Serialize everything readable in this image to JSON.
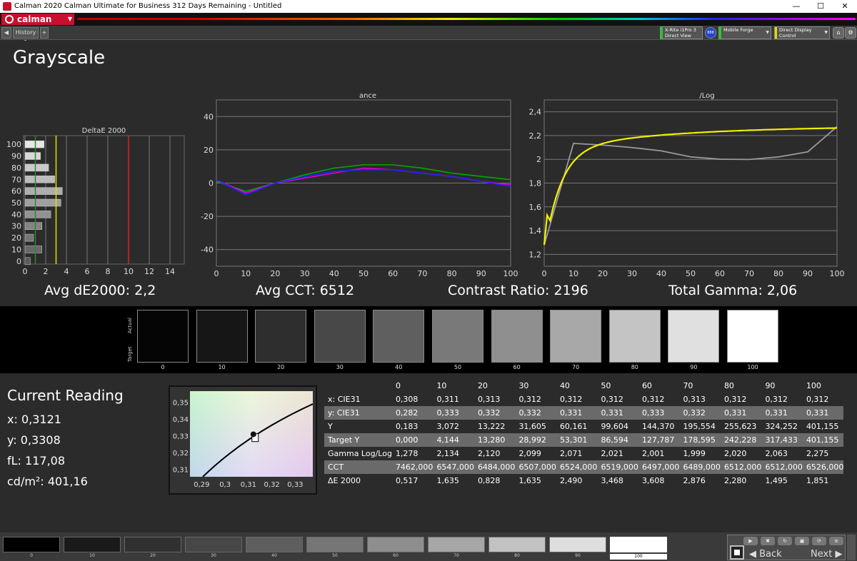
{
  "window": {
    "title": "Calman 2020 Calman Ultimate for Business 312 Days Remaining - Untitled",
    "minimize": "—",
    "maximize": "☐",
    "close": "✕"
  },
  "logo": {
    "text": "calman",
    "dropdown": "▼"
  },
  "tabs": {
    "back_arrow": "◀",
    "history_tab": "History 1",
    "add_tab": "+"
  },
  "devices": [
    {
      "line1": "X-Rite i1Pro 3",
      "line2": "Direct View",
      "color": "#22cc22"
    },
    {
      "line1": "Mobile Forge",
      "line2": "",
      "color": "#22cc22"
    },
    {
      "line1": "Direct Display Control",
      "line2": "",
      "color": "#dddd00"
    }
  ],
  "device_badge": "888",
  "page_title": "Grayscale",
  "deltae_chart": {
    "title": "DeltaE 2000",
    "categories": [
      "0",
      "10",
      "20",
      "30",
      "40",
      "50",
      "60",
      "70",
      "80",
      "90",
      "100"
    ],
    "x_ticks": [
      "0",
      "2",
      "4",
      "6",
      "8",
      "10",
      "12",
      "14"
    ],
    "y_ticks": [
      "100",
      "90",
      "80",
      "70",
      "60",
      "50",
      "40",
      "30",
      "20",
      "10",
      "0"
    ]
  },
  "rgb_chart": {
    "title": "RGB Balance",
    "visible_title": "ance",
    "x_ticks": [
      "0",
      "10",
      "20",
      "30",
      "40",
      "50",
      "60",
      "70",
      "80",
      "90",
      "100"
    ],
    "y_ticks": [
      "40",
      "20",
      "0",
      "-20",
      "-40"
    ]
  },
  "gamma_chart": {
    "visible_title": "/Log",
    "x_ticks": [
      "0",
      "10",
      "20",
      "30",
      "40",
      "50",
      "60",
      "70",
      "80",
      "90",
      "100"
    ],
    "y_ticks": [
      "2,4",
      "2,2",
      "2",
      "1,8",
      "1,6",
      "1,4",
      "1,2"
    ]
  },
  "chart_data": [
    {
      "type": "bar",
      "title": "DeltaE 2000",
      "orientation": "horizontal",
      "categories": [
        "0",
        "10",
        "20",
        "30",
        "40",
        "50",
        "60",
        "70",
        "80",
        "90",
        "100"
      ],
      "values": [
        0.517,
        1.635,
        0.828,
        1.635,
        2.49,
        3.468,
        3.608,
        2.876,
        2.28,
        1.495,
        1.851
      ],
      "xlim": [
        0,
        15
      ],
      "reference_lines": [
        {
          "value": 3,
          "color": "#e0e000"
        },
        {
          "value": 10,
          "color": "#dd2222"
        }
      ]
    },
    {
      "type": "line",
      "x": [
        0,
        10,
        20,
        30,
        40,
        50,
        60,
        70,
        80,
        90,
        100
      ],
      "ylim": [
        -50,
        50
      ],
      "series": [
        {
          "color": "#00aa00",
          "values": [
            1,
            -5,
            0,
            5,
            9,
            11,
            11,
            9,
            6,
            4,
            2
          ]
        },
        {
          "color": "#dd00dd",
          "values": [
            2,
            -6,
            0,
            3,
            6,
            9,
            8,
            6,
            4,
            1,
            -1
          ]
        },
        {
          "color": "#2222ff",
          "values": [
            2,
            -7,
            0,
            4,
            7,
            8,
            8,
            6,
            4,
            1,
            -2
          ]
        }
      ]
    },
    {
      "type": "line",
      "x": [
        0,
        10,
        20,
        30,
        40,
        50,
        60,
        70,
        80,
        90,
        100
      ],
      "ylim": [
        1.1,
        2.5
      ],
      "series": [
        {
          "color": "#9a9a9a",
          "values": [
            1.278,
            2.134,
            2.12,
            2.099,
            2.071,
            2.021,
            2.001,
            1.999,
            2.02,
            2.063,
            2.275
          ]
        },
        {
          "color": "#f0f000",
          "curve": "gamma",
          "values": [
            1.28,
            1.95,
            2.08,
            2.13,
            2.16,
            2.19,
            2.21,
            2.23,
            2.25,
            2.27,
            2.28
          ]
        }
      ]
    },
    {
      "type": "scatter",
      "x_ticks": [
        "0,29",
        "0,3",
        "0,31",
        "0,32",
        "0,33"
      ],
      "y_ticks": [
        "0,35",
        "0,34",
        "0,33",
        "0,32",
        "0,31"
      ],
      "xlim": [
        0.285,
        0.3375
      ],
      "ylim": [
        0.3055,
        0.3565
      ],
      "points": [
        {
          "x": 0.3127,
          "y": 0.329,
          "label": "target"
        },
        {
          "x": 0.3121,
          "y": 0.3308,
          "label": "measured"
        }
      ]
    }
  ],
  "stats": {
    "avg_de": "Avg dE2000: 2,2",
    "avg_cct": "Avg CCT: 6512",
    "contrast": "Contrast Ratio: 2196",
    "total_gamma": "Total Gamma: 2,06"
  },
  "patches": {
    "actual_label": "Actual",
    "target_label": "Target",
    "labels": [
      "0",
      "10",
      "20",
      "30",
      "40",
      "50",
      "60",
      "70",
      "80",
      "90",
      "100"
    ],
    "actual_colors": [
      "#050505",
      "#161616",
      "#2e2e2e",
      "#484848",
      "#5f5f5f",
      "#797979",
      "#8f8f8f",
      "#a8a8a8",
      "#c4c4c4",
      "#e0e0e0",
      "#ffffff"
    ],
    "target_colors": [
      "#050505",
      "#161616",
      "#2e2e2e",
      "#484848",
      "#5f5f5f",
      "#797979",
      "#8f8f8f",
      "#a8a8a8",
      "#c4c4c4",
      "#e0e0e0",
      "#ffffff"
    ]
  },
  "current_reading": {
    "title": "Current Reading",
    "x": "x: 0,3121",
    "y": "y: 0,3308",
    "fl": "fL: 117,08",
    "cd": "cd/m²: 401,16"
  },
  "table": {
    "headers": [
      "",
      "0",
      "10",
      "20",
      "30",
      "40",
      "50",
      "60",
      "70",
      "80",
      "90",
      "100"
    ],
    "rows": [
      [
        "x: CIE31",
        "0,308",
        "0,311",
        "0,313",
        "0,312",
        "0,312",
        "0,312",
        "0,312",
        "0,313",
        "0,312",
        "0,312",
        "0,312"
      ],
      [
        "y: CIE31",
        "0,282",
        "0,333",
        "0,332",
        "0,332",
        "0,331",
        "0,331",
        "0,333",
        "0,332",
        "0,331",
        "0,331",
        "0,331"
      ],
      [
        "Y",
        "0,183",
        "3,072",
        "13,222",
        "31,605",
        "60,161",
        "99,604",
        "144,370",
        "195,554",
        "255,623",
        "324,252",
        "401,155"
      ],
      [
        "Target Y",
        "0,000",
        "4,144",
        "13,280",
        "28,992",
        "53,301",
        "86,594",
        "127,787",
        "178,595",
        "242,228",
        "317,433",
        "401,155"
      ],
      [
        "Gamma Log/Log",
        "1,278",
        "2,134",
        "2,120",
        "2,099",
        "2,071",
        "2,021",
        "2,001",
        "1,999",
        "2,020",
        "2,063",
        "2,275"
      ],
      [
        "CCT",
        "7462,000",
        "6547,000",
        "6484,000",
        "6507,000",
        "6524,000",
        "6519,000",
        "6497,000",
        "6489,000",
        "6512,000",
        "6512,000",
        "6526,000"
      ],
      [
        "ΔE 2000",
        "0,517",
        "1,635",
        "0,828",
        "1,635",
        "2,490",
        "3,468",
        "3,608",
        "2,876",
        "2,280",
        "1,495",
        "1,851"
      ]
    ]
  },
  "footer": {
    "labels": [
      "0",
      "10",
      "20",
      "30",
      "40",
      "50",
      "60",
      "70",
      "80",
      "90",
      "100"
    ],
    "colors": [
      "#000000",
      "#1a1a1a",
      "#303030",
      "#474747",
      "#5e5e5e",
      "#767676",
      "#8e8e8e",
      "#a6a6a6",
      "#c2c2c2",
      "#dedede",
      "#ffffff"
    ],
    "selected": "100",
    "back": "Back",
    "next": "Next"
  }
}
